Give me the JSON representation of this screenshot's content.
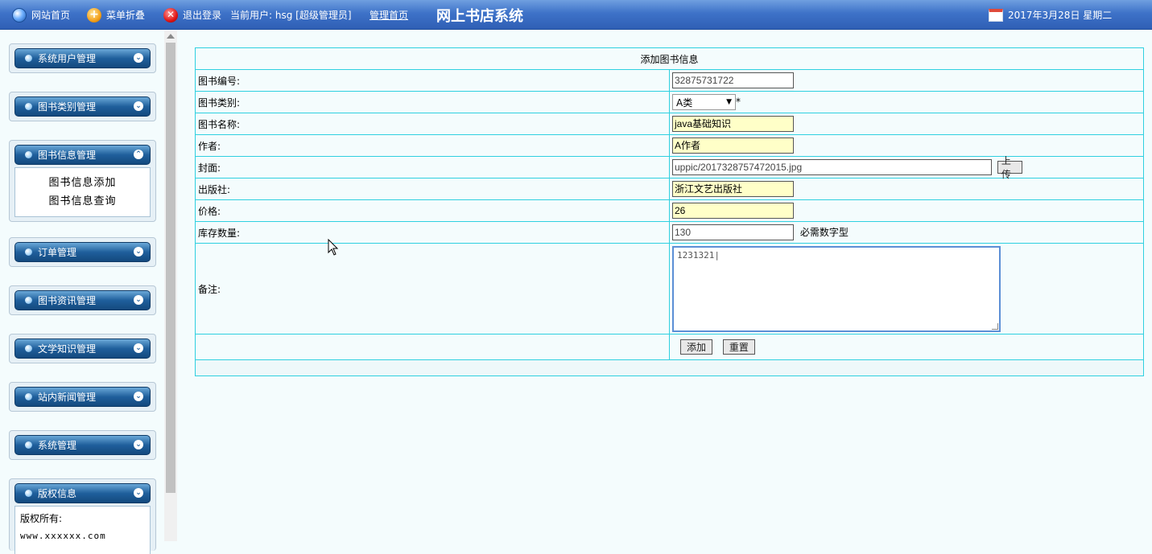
{
  "topbar": {
    "site_home": "网站首页",
    "menu_fold": "菜单折叠",
    "logout": "退出登录",
    "current_user": "当前用户: hsg [超级管理员]",
    "admin_home": "管理首页",
    "system_title": "网上书店系统",
    "date": "2017年3月28日 星期二"
  },
  "sidebar": {
    "menus": [
      {
        "label": "系统用户管理",
        "expanded": false
      },
      {
        "label": "图书类别管理",
        "expanded": false
      },
      {
        "label": "图书信息管理",
        "expanded": true,
        "items": [
          "图书信息添加",
          "图书信息查询"
        ]
      },
      {
        "label": "订单管理",
        "expanded": false
      },
      {
        "label": "图书资讯管理",
        "expanded": false
      },
      {
        "label": "文学知识管理",
        "expanded": false
      },
      {
        "label": "站内新闻管理",
        "expanded": false
      },
      {
        "label": "系统管理",
        "expanded": false
      },
      {
        "label": "版权信息",
        "expanded": true
      }
    ],
    "copyright_label": "版权所有:",
    "copyright_site": "www.xxxxxx.com"
  },
  "form": {
    "title": "添加图书信息",
    "book_no_label": "图书编号:",
    "book_no_value": "32875731722",
    "category_label": "图书类别:",
    "category_value": "A类",
    "required_mark": "*",
    "book_name_label": "图书名称:",
    "book_name_value": "java基础知识",
    "author_label": "作者:",
    "author_value": "A作者",
    "cover_label": "封面:",
    "cover_value": "uppic/2017328757472015.jpg",
    "upload_button": "上传",
    "publisher_label": "出版社:",
    "publisher_value": "浙江文艺出版社",
    "price_label": "价格:",
    "price_value": "26",
    "stock_label": "库存数量:",
    "stock_value": "130",
    "stock_hint": "必需数字型",
    "remark_label": "备注:",
    "remark_value": "1231321|",
    "add_button": "添加",
    "reset_button": "重置"
  },
  "colors": {
    "topbar": "#3e72c8",
    "table_border": "#2fd0e0",
    "input_highlight": "#ffffc8",
    "menu_head": "#1f5f9c"
  }
}
